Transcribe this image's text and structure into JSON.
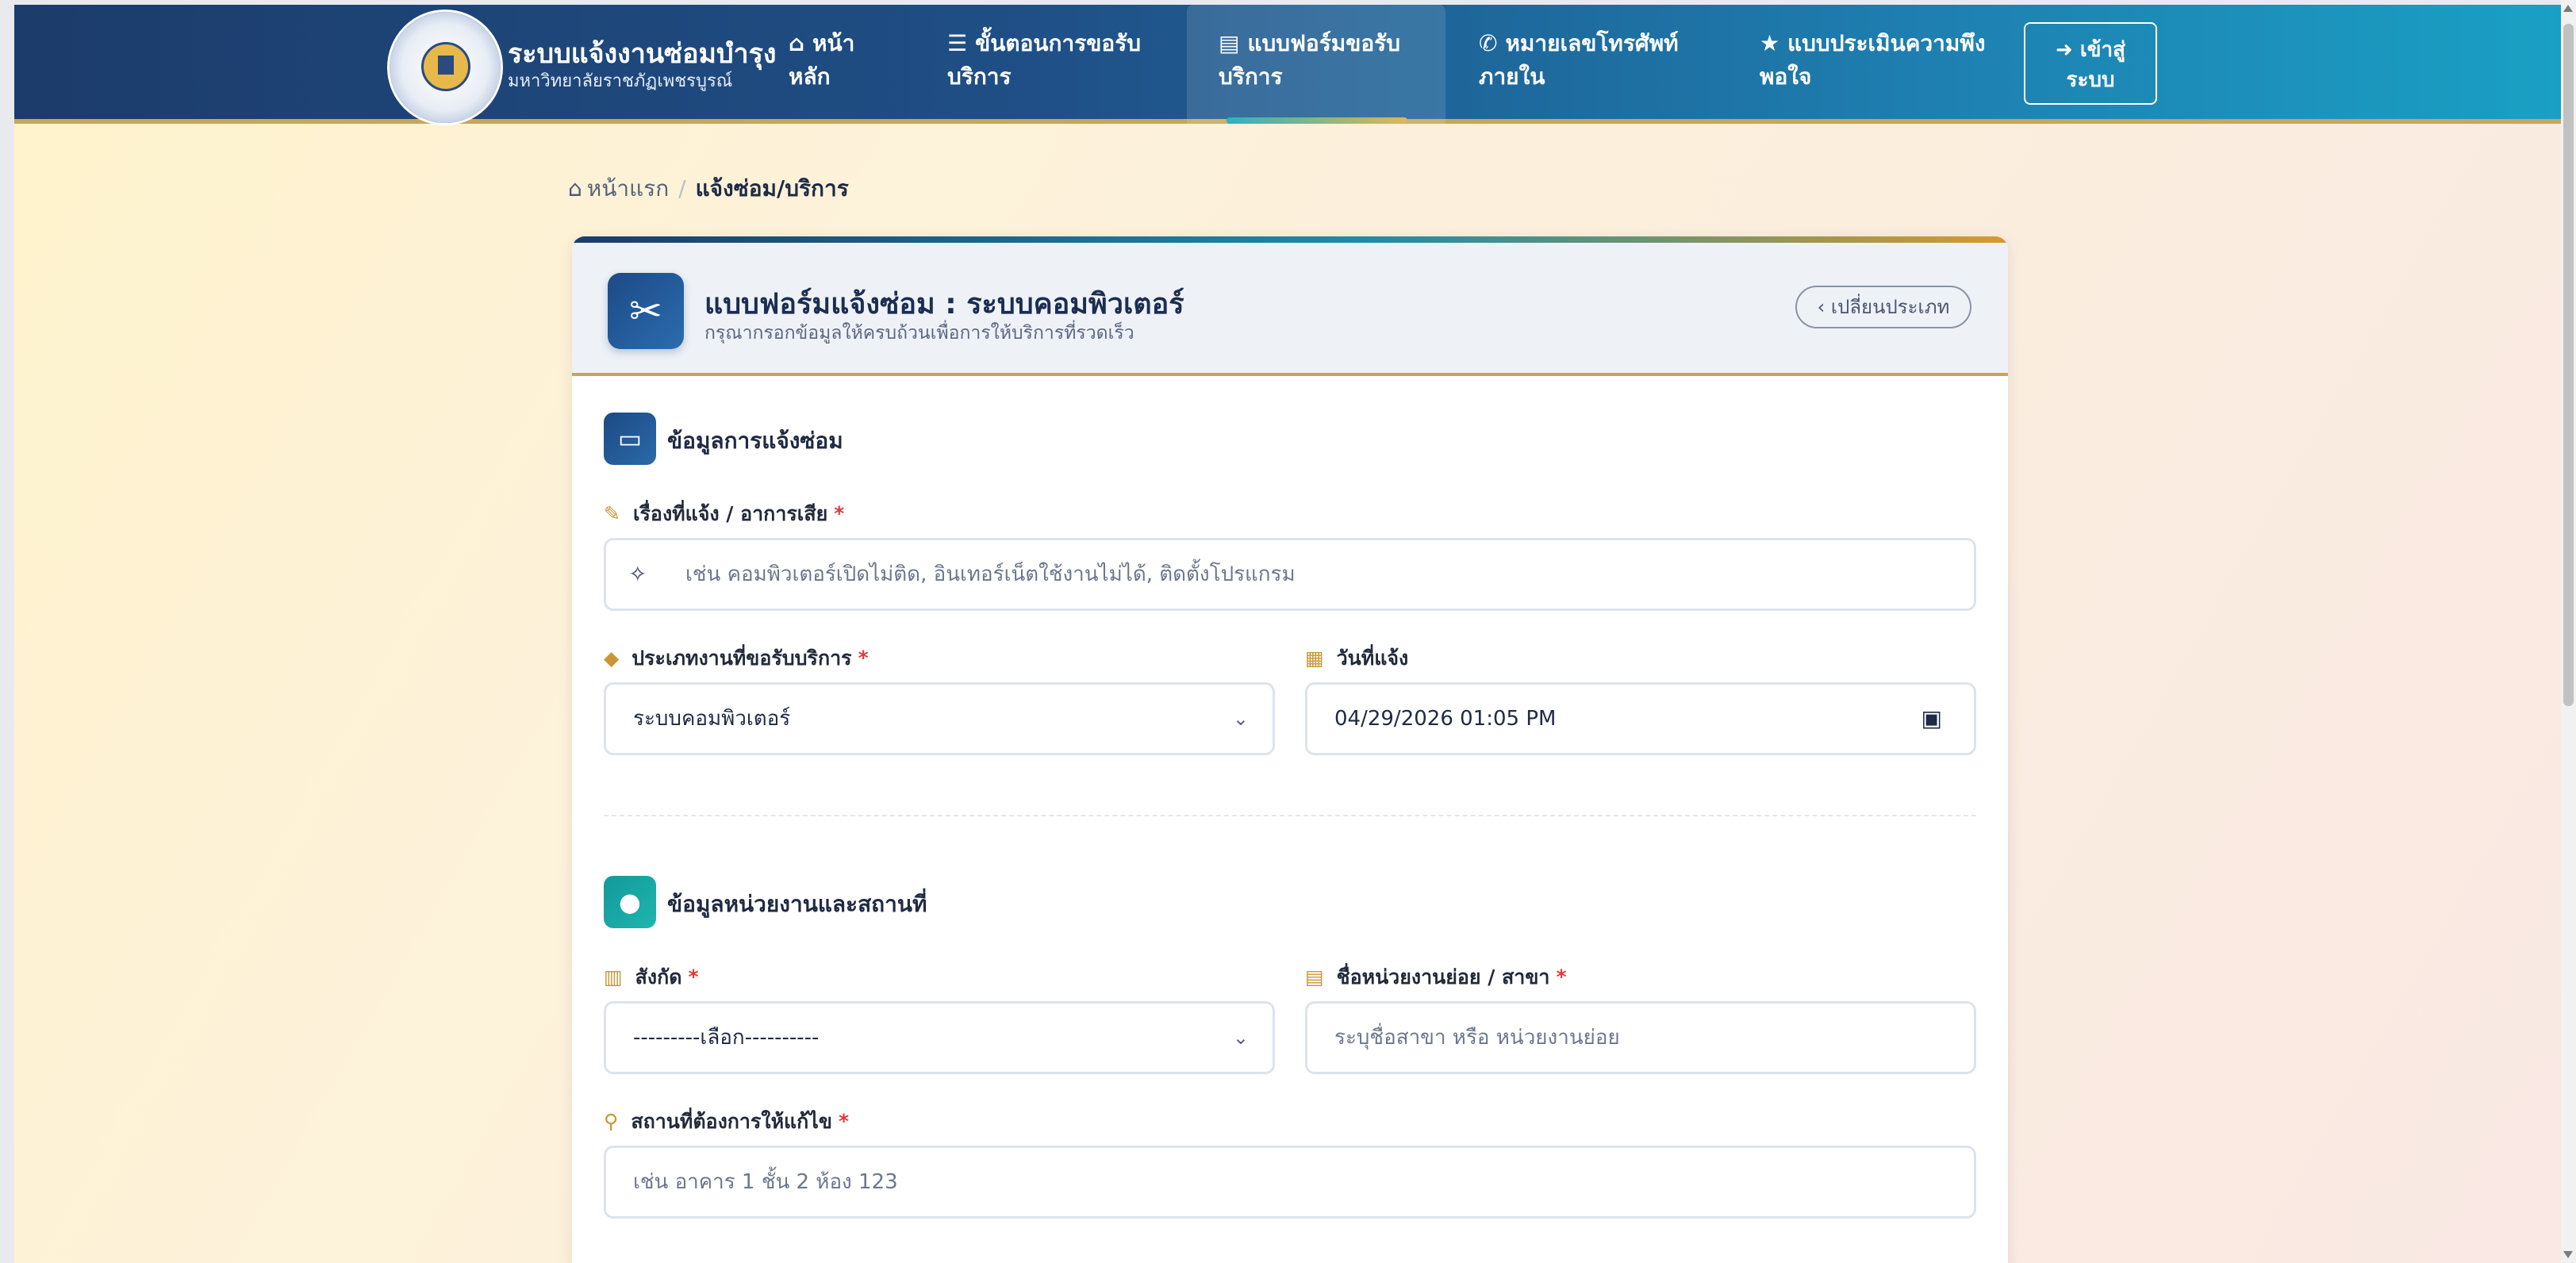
{
  "navbar": {
    "brand_title": "ระบบแจ้งงานซ่อมบำรุง",
    "brand_subtitle": "มหาวิทยาลัยราชภัฏเพชรบูรณ์",
    "items": [
      {
        "icon": "home-icon",
        "label": "หน้าหลัก",
        "line1": "หน้า",
        "line2": "หลัก"
      },
      {
        "icon": "list-check-icon",
        "label": "ขั้นตอนการขอรับบริการ",
        "line1": "ขั้นตอนการขอรับ",
        "line2": "บริการ"
      },
      {
        "icon": "file-icon",
        "label": "แบบฟอร์มขอรับบริการ",
        "line1": "แบบฟอร์มขอรับ",
        "line2": "บริการ",
        "active": true
      },
      {
        "icon": "phone-icon",
        "label": "หมายเลขโทรศัพท์ภายใน",
        "line1": "หมายเลขโทรศัพท์",
        "line2": "ภายใน"
      },
      {
        "icon": "star-icon",
        "label": "แบบประเมินความพึงพอใจ",
        "line1": "แบบประเมินความพึง",
        "line2": "พอใจ"
      }
    ],
    "login": {
      "icon": "login-icon",
      "line1": "เข้าสู่",
      "line2": "ระบบ"
    },
    "accent_color": "#c9a55a"
  },
  "breadcrumb": {
    "home": "หน้าแรก",
    "current": "แจ้งซ่อม/บริการ"
  },
  "form": {
    "title": "แบบฟอร์มแจ้งซ่อม : ระบบคอมพิวเตอร์",
    "subtitle": "กรุณากรอกข้อมูลให้ครบถ้วนเพื่อการให้บริการที่รวดเร็ว",
    "change_type_label": "เปลี่ยนประเภท",
    "section1": {
      "title": "ข้อมูลการแจ้งซ่อม",
      "issue": {
        "label": "เรื่องที่แจ้ง / อาการเสีย",
        "required": "*",
        "placeholder": "เช่น คอมพิวเตอร์เปิดไม่ติด, อินเทอร์เน็ตใช้งานไม่ได้, ติดตั้งโปรแกรม"
      },
      "service_type": {
        "label": "ประเภทงานที่ขอรับบริการ",
        "required": "*",
        "value": "ระบบคอมพิวเตอร์"
      },
      "date": {
        "label": "วันที่แจ้ง",
        "value": "04/29/2026 01:05 PM"
      }
    },
    "section2": {
      "title": "ข้อมูลหน่วยงานและสถานที่",
      "affiliation": {
        "label": "สังกัด",
        "required": "*",
        "value": "---------เลือก----------"
      },
      "unit_name": {
        "label": "ชื่อหน่วยงานย่อย / สาขา",
        "required": "*",
        "placeholder": "ระบุชื่อสาขา หรือ หน่วยงานย่อย"
      },
      "location": {
        "label": "สถานที่ต้องการให้แก้ไข",
        "required": "*",
        "placeholder": "เช่น อาคาร 1 ชั้น 2 ห้อง 123"
      }
    }
  }
}
